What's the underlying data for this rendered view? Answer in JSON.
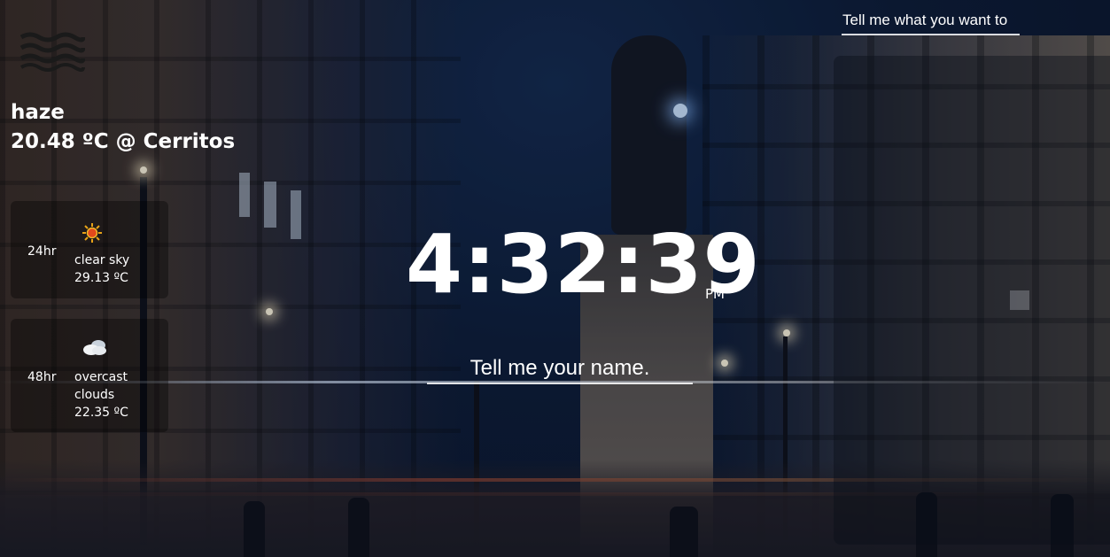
{
  "weather": {
    "icon": "haze-icon",
    "description": "haze",
    "current": "20.48 ºC @ Cerritos",
    "forecast": [
      {
        "hour": "24hr",
        "icon": "sun-icon",
        "description": "clear sky",
        "temp": "29.13 ºC"
      },
      {
        "hour": "48hr",
        "icon": "cloud-icon",
        "description": "overcast clouds",
        "temp": "22.35 ºC"
      }
    ]
  },
  "clock": {
    "time": "4:32:39",
    "ampm": "PM"
  },
  "name_prompt": {
    "placeholder": "Tell me your name."
  },
  "wish_prompt": {
    "placeholder": "Tell me what you want to"
  },
  "colors": {
    "text": "#ffffff",
    "panel": "rgba(10,15,25,0.42)",
    "card": "rgba(0,0,0,0.35)"
  }
}
